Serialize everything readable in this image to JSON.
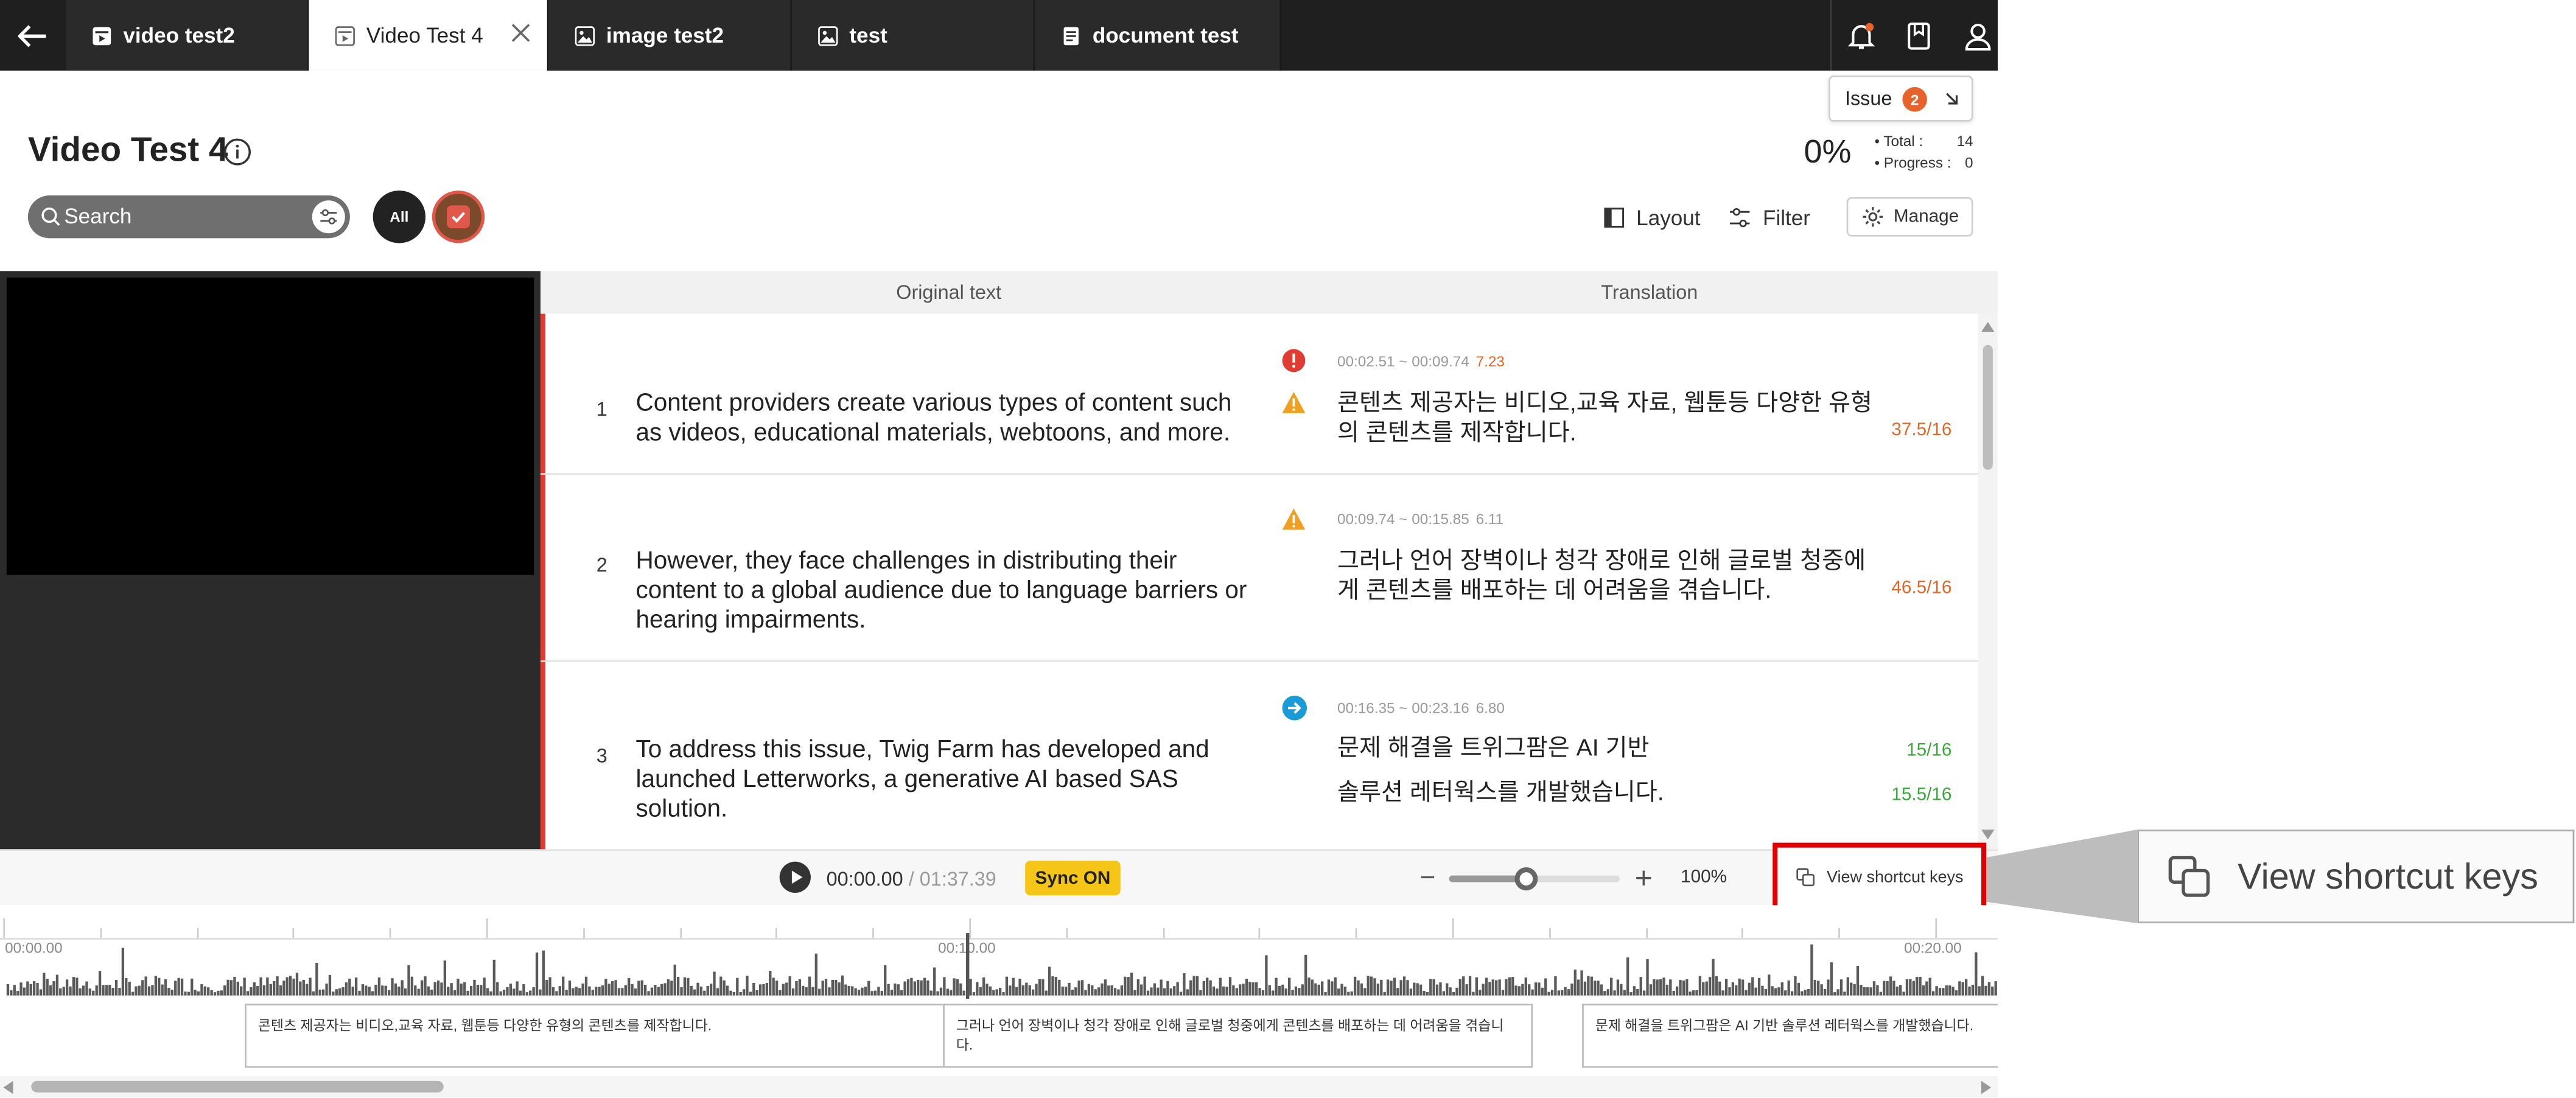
{
  "tabs": [
    {
      "label": "video test2",
      "icon": "video-icon",
      "active": false
    },
    {
      "label": "Video Test 4",
      "icon": "video-icon",
      "active": true
    },
    {
      "label": "image test2",
      "icon": "image-icon",
      "active": false
    },
    {
      "label": "test",
      "icon": "image-icon",
      "active": false
    },
    {
      "label": "document test",
      "icon": "document-icon",
      "active": false
    }
  ],
  "header": {
    "title": "Video Test 4",
    "search_placeholder": "Search",
    "all_chip": "All",
    "issue_label": "Issue",
    "issue_count": "2",
    "progress_pct": "0%",
    "total_label": "• Total :",
    "total_value": "14",
    "progress_label": "• Progress :",
    "progress_value": "0",
    "layout_label": "Layout",
    "filter_label": "Filter",
    "manage_label": "Manage"
  },
  "table": {
    "col_original": "Original text",
    "col_translation": "Translation",
    "rows": [
      {
        "num": "1",
        "original": "Content providers create various types of content such as videos, educational materials, webtoons, and more.",
        "time": "00:02.51 ~ 00:09.74",
        "duration": "7.23",
        "lines": [
          {
            "text": "콘텐츠 제공자는 비디오,교육 자료, 웹툰등 다양한 유형의 콘텐츠를 제작합니다.",
            "score": "37.5/16"
          }
        ]
      },
      {
        "num": "2",
        "original": "However, they face challenges in distributing their content to a global audience due to language barriers or hearing impairments.",
        "time": "00:09.74 ~ 00:15.85",
        "duration": "6.11",
        "lines": [
          {
            "text": "그러나 언어 장벽이나 청각 장애로 인해 글로벌 청중에게 콘텐츠를 배포하는 데 어려움을 겪습니다.",
            "score": "46.5/16"
          }
        ]
      },
      {
        "num": "3",
        "original": "To address this issue, Twig Farm has developed and launched Letterworks, a generative AI based SAS solution.",
        "time": "00:16.35 ~ 00:23.16",
        "duration": "6.80",
        "lines": [
          {
            "text": "문제 해결을 트위그팜은 AI 기반",
            "score": "15/16"
          },
          {
            "text": "솔루션 레터웍스를 개발했습니다.",
            "score": "15.5/16"
          }
        ]
      }
    ]
  },
  "player": {
    "current_time": "00:00.00",
    "total_time": "/ 01:37.39",
    "sync_label": "Sync ON",
    "zoom": "100%",
    "zoom_level": 0.45,
    "shortcut_label": "View shortcut keys"
  },
  "timeline": {
    "ticks": [
      "00:00.00",
      "00:10.00",
      "00:20.00"
    ],
    "blocks": [
      "콘텐츠 제공자는 비디오,교육 자료, 웹툰등 다양한 유형의 콘텐츠를 제작합니다.",
      "그러나 언어 장벽이나 청각 장애로 인해 글로벌 청중에게 콘텐츠를 배포하는 데 어려움을 겪습니다.",
      "문제 해결을 트위그팜은 AI 기반 솔루션 레터웍스를 개발했습니다."
    ]
  },
  "callout": {
    "label": "View shortcut keys"
  },
  "colors": {
    "accent_red": "#e03c31",
    "score_orange": "#e0682a",
    "score_green": "#3aa83a",
    "sync_yellow": "#f5c518",
    "warning": "#f0a020",
    "info_blue": "#1a9ad6"
  }
}
